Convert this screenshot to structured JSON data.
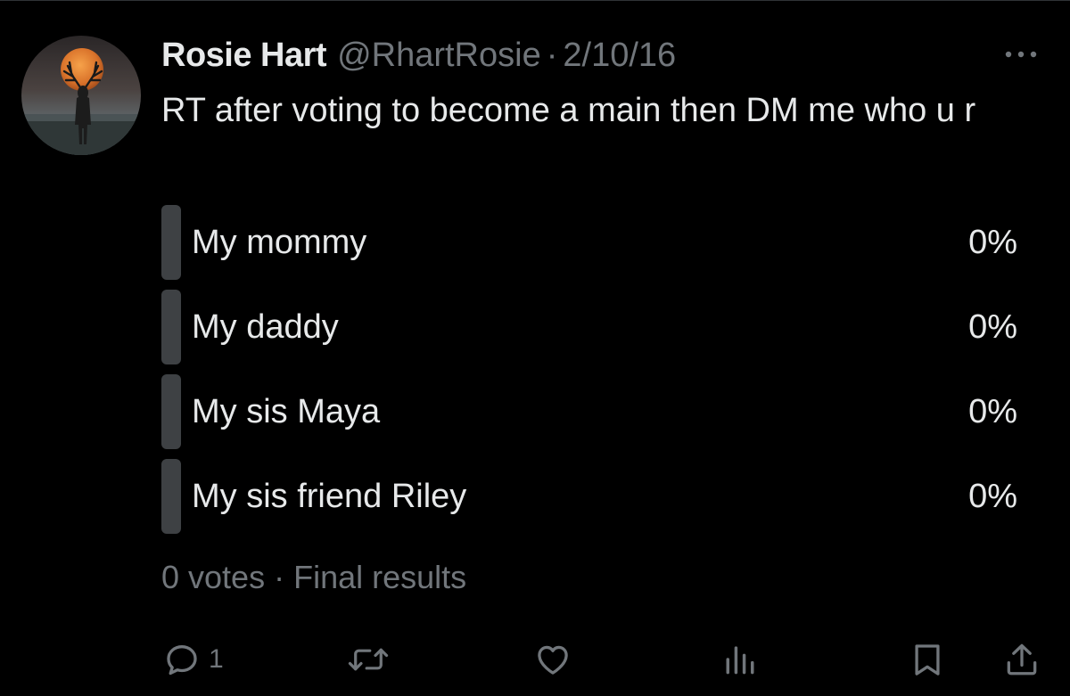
{
  "tweet": {
    "author_name": "Rosie Hart",
    "handle": "@RhartRosie",
    "separator": "·",
    "date": "2/10/16",
    "text": "RT after voting to become a main then DM me who u r"
  },
  "poll": {
    "options": [
      {
        "label": "My mommy",
        "percent": "0%"
      },
      {
        "label": "My daddy",
        "percent": "0%"
      },
      {
        "label": "My sis Maya",
        "percent": "0%"
      },
      {
        "label": "My sis friend Riley",
        "percent": "0%"
      }
    ],
    "votes": "0 votes",
    "separator": "·",
    "status": "Final results"
  },
  "actions": {
    "reply_count": "1",
    "icons": [
      "reply-icon",
      "retweet-icon",
      "like-icon",
      "views-icon",
      "bookmark-icon",
      "share-icon"
    ]
  },
  "colors": {
    "background": "#000000",
    "text_primary": "#e7e9ea",
    "text_secondary": "#71767b",
    "poll_bar": "#3e4144"
  }
}
